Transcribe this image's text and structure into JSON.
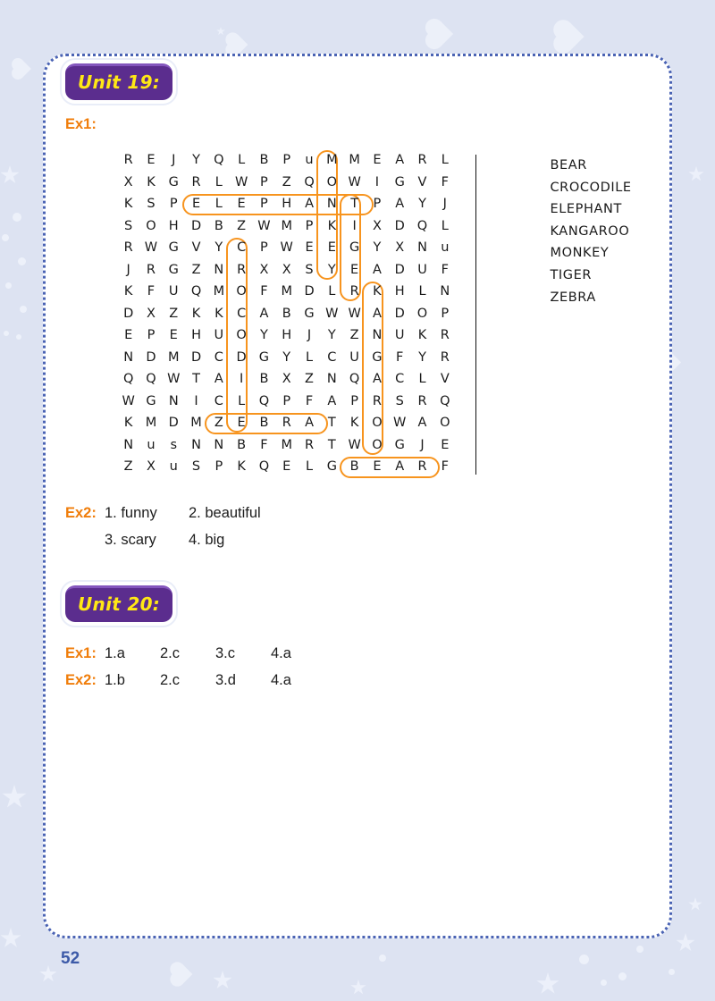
{
  "page": {
    "number": "52",
    "accent_orange": "#f07d0a",
    "highlight_orange": "#f7941e",
    "badge_purple": "#5b2d8e",
    "badge_yellow": "#ffe815",
    "border_blue": "#4a63b4",
    "background": "#dde3f2"
  },
  "unit19": {
    "badge": "Unit 19:",
    "ex1_label": "Ex1:",
    "ex2_label": "Ex2:",
    "ex2_answers": [
      "1. funny",
      "2. beautiful",
      "3. scary",
      "4. big"
    ]
  },
  "unit20": {
    "badge": "Unit 20:",
    "ex1_label": "Ex1:",
    "ex2_label": "Ex2:",
    "ex1_answers": [
      "1.a",
      "2.c",
      "3.c",
      "4.a"
    ],
    "ex2_answers": [
      "1.b",
      "2.c",
      "3.d",
      "4.a"
    ]
  },
  "wordsearch": {
    "rows": 15,
    "cols": 15,
    "grid": [
      [
        "R",
        "E",
        "J",
        "Y",
        "Q",
        "L",
        "B",
        "P",
        "u",
        "M",
        "M",
        "E",
        "A",
        "R",
        "L"
      ],
      [
        "X",
        "K",
        "G",
        "R",
        "L",
        "W",
        "P",
        "Z",
        "Q",
        "O",
        "W",
        "I",
        "G",
        "V",
        "F"
      ],
      [
        "K",
        "S",
        "P",
        "E",
        "L",
        "E",
        "P",
        "H",
        "A",
        "N",
        "T",
        "P",
        "A",
        "Y",
        "J"
      ],
      [
        "S",
        "O",
        "H",
        "D",
        "B",
        "Z",
        "W",
        "M",
        "P",
        "K",
        "I",
        "X",
        "D",
        "Q",
        "L"
      ],
      [
        "R",
        "W",
        "G",
        "V",
        "Y",
        "C",
        "P",
        "W",
        "E",
        "E",
        "G",
        "Y",
        "X",
        "N",
        "u"
      ],
      [
        "J",
        "R",
        "G",
        "Z",
        "N",
        "R",
        "X",
        "X",
        "S",
        "Y",
        "E",
        "A",
        "D",
        "U",
        "F"
      ],
      [
        "K",
        "F",
        "U",
        "Q",
        "M",
        "O",
        "F",
        "M",
        "D",
        "L",
        "R",
        "K",
        "H",
        "L",
        "N"
      ],
      [
        "D",
        "X",
        "Z",
        "K",
        "K",
        "C",
        "A",
        "B",
        "G",
        "W",
        "W",
        "A",
        "D",
        "O",
        "P"
      ],
      [
        "E",
        "P",
        "E",
        "H",
        "U",
        "O",
        "Y",
        "H",
        "J",
        "Y",
        "Z",
        "N",
        "U",
        "K",
        "R"
      ],
      [
        "N",
        "D",
        "M",
        "D",
        "C",
        "D",
        "G",
        "Y",
        "L",
        "C",
        "U",
        "G",
        "F",
        "Y",
        "R"
      ],
      [
        "Q",
        "Q",
        "W",
        "T",
        "A",
        "I",
        "B",
        "X",
        "Z",
        "N",
        "Q",
        "A",
        "C",
        "L",
        "V"
      ],
      [
        "W",
        "G",
        "N",
        "I",
        "C",
        "L",
        "Q",
        "P",
        "F",
        "A",
        "P",
        "R",
        "S",
        "R",
        "Q"
      ],
      [
        "K",
        "M",
        "D",
        "M",
        "Z",
        "E",
        "B",
        "R",
        "A",
        "T",
        "K",
        "O",
        "W",
        "A",
        "O"
      ],
      [
        "N",
        "u",
        "s",
        "N",
        "N",
        "B",
        "F",
        "M",
        "R",
        "T",
        "W",
        "O",
        "G",
        "J",
        "E"
      ],
      [
        "Z",
        "X",
        "u",
        "S",
        "P",
        "K",
        "Q",
        "E",
        "L",
        "G",
        "B",
        "E",
        "A",
        "R",
        "F"
      ]
    ],
    "words": [
      "BEAR",
      "CROCODILE",
      "ELEPHANT",
      "KANGAROO",
      "MONKEY",
      "TIGER",
      "ZEBRA"
    ],
    "found": [
      {
        "word": "ELEPHANT",
        "direction": "horizontal",
        "row": 2,
        "col_start": 3,
        "col_end": 10
      },
      {
        "word": "MONKEY",
        "direction": "vertical",
        "col": 9,
        "row_start": 0,
        "row_end": 5
      },
      {
        "word": "TIGER",
        "direction": "vertical",
        "col": 10,
        "row_start": 2,
        "row_end": 6
      },
      {
        "word": "CROCODILE",
        "direction": "vertical",
        "col": 5,
        "row_start": 4,
        "row_end": 12
      },
      {
        "word": "KANGAROO",
        "direction": "vertical",
        "col": 11,
        "row_start": 6,
        "row_end": 13
      },
      {
        "word": "ZEBRA",
        "direction": "horizontal",
        "row": 12,
        "col_start": 4,
        "col_end": 8
      },
      {
        "word": "BEAR",
        "direction": "horizontal",
        "row": 14,
        "col_start": 10,
        "col_end": 13
      }
    ]
  }
}
